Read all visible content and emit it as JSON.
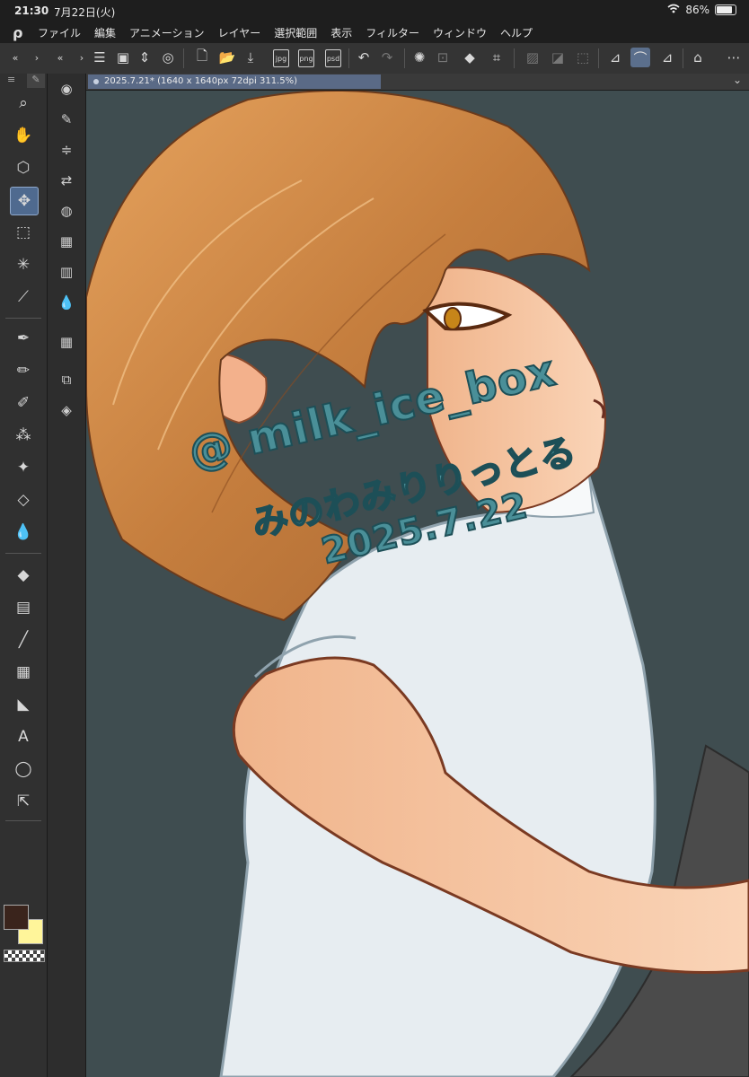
{
  "status": {
    "time": "21:30",
    "date": "7月22日(火)",
    "battery": "86%",
    "battery_level": 0.86
  },
  "menu": {
    "items": [
      "ファイル",
      "編集",
      "アニメーション",
      "レイヤー",
      "選択範囲",
      "表示",
      "フィルター",
      "ウィンドウ",
      "ヘルプ"
    ]
  },
  "toolbar": {
    "jpg_label": "jpg",
    "png_label": "png",
    "psd_label": "psd"
  },
  "canvas": {
    "tab_title": "2025.7.21* (1640 x 1640px 72dpi 311.5%)"
  },
  "artwork": {
    "watermark_handle": "@ milk_ice_box",
    "watermark_name": "みのわみりりっとる",
    "watermark_date": "2025.7.22"
  },
  "colors": {
    "main": "#3a241c",
    "sub": "#fff59a",
    "canvas_bg": "#3f4d50",
    "accent": "#5b6f8c"
  }
}
